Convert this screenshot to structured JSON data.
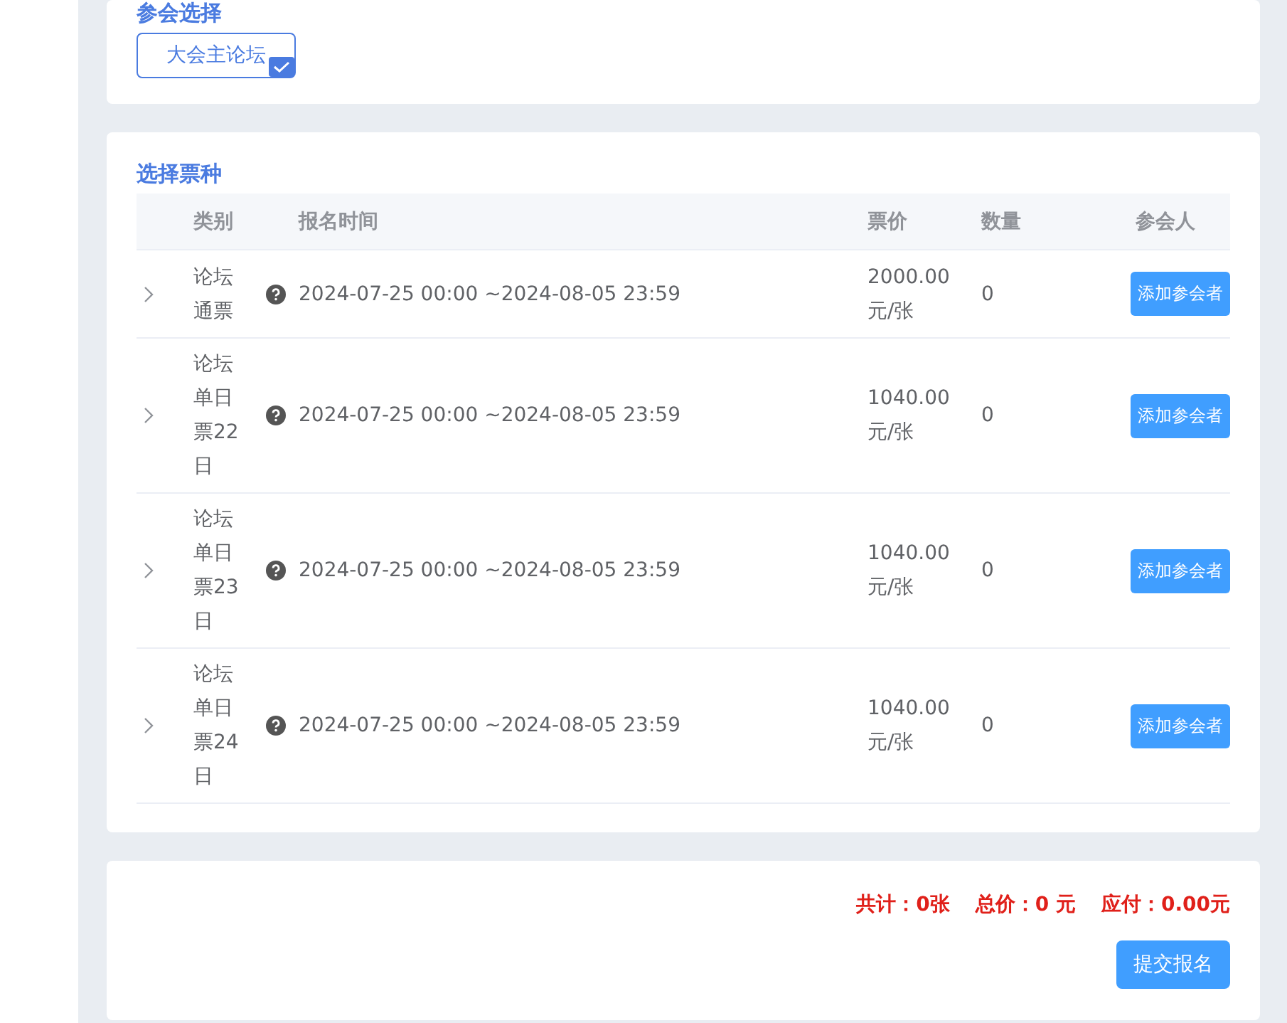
{
  "attend_section": {
    "title": "参会选择",
    "options": [
      {
        "label": "大会主论坛",
        "selected": true
      }
    ]
  },
  "ticket_section": {
    "title": "选择票种",
    "columns": [
      "类别",
      "报名时间",
      "票价",
      "数量",
      "参会人"
    ],
    "rows": [
      {
        "category": "论坛通票",
        "time": "2024-07-25 00:00 ~2024-08-05 23:59",
        "price": "2000.00 元/张",
        "quantity": "0",
        "action": "添加参会者",
        "expanded": false
      },
      {
        "category": "论坛单日票22日",
        "time": "2024-07-25 00:00 ~2024-08-05 23:59",
        "price": "1040.00 元/张",
        "quantity": "0",
        "action": "添加参会者",
        "expanded": false
      },
      {
        "category": "论坛单日票23日",
        "time": "2024-07-25 00:00 ~2024-08-05 23:59",
        "price": "1040.00 元/张",
        "quantity": "0",
        "action": "添加参会者",
        "expanded": false
      },
      {
        "category": "论坛单日票24日",
        "time": "2024-07-25 00:00 ~2024-08-05 23:59",
        "price": "1040.00 元/张",
        "quantity": "0",
        "action": "添加参会者",
        "expanded": false
      }
    ]
  },
  "summary": {
    "total_count": "共计：0张",
    "total_price": "总价：0 元",
    "payable": "应付：0.00元",
    "submit": "提交报名"
  }
}
